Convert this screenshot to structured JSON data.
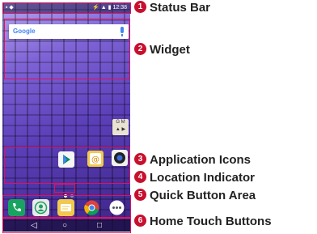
{
  "status_bar": {
    "left_icons": "▪ ◆",
    "time": "12:38"
  },
  "widget": {
    "search_logo": "Google"
  },
  "folder": {
    "label_top": "G M",
    "label_bottom": "▲ ▶"
  },
  "callouts": [
    {
      "number": "1",
      "label": "Status Bar"
    },
    {
      "number": "2",
      "label": "Widget"
    },
    {
      "number": "3",
      "label": "Application Icons"
    },
    {
      "number": "4",
      "label": "Location Indicator"
    },
    {
      "number": "5",
      "label": "Quick Button Area"
    },
    {
      "number": "6",
      "label": "Home Touch Buttons"
    }
  ],
  "colors": {
    "accent": "#e0115f",
    "badge": "#c8102e"
  }
}
